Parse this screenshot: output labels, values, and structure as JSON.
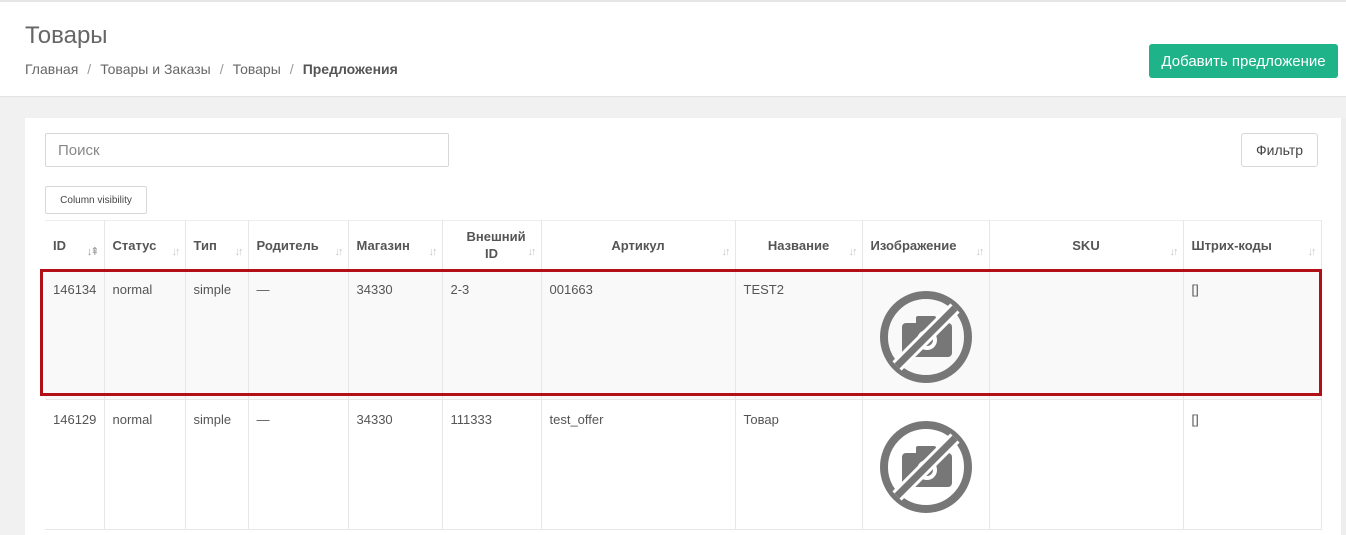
{
  "header": {
    "title": "Товары",
    "breadcrumb": [
      "Главная",
      "Товары и Заказы",
      "Товары",
      "Предложения"
    ],
    "add_button": "Добавить предложение"
  },
  "toolbar": {
    "search_placeholder": "Поиск",
    "filter_label": "Фильтр",
    "column_visibility_label": "Column visibility"
  },
  "table": {
    "columns": [
      "ID",
      "Статус",
      "Тип",
      "Родитель",
      "Магазин",
      "Внешний ID",
      "Артикул",
      "Название",
      "Изображение",
      "SKU",
      "Штрих-коды"
    ],
    "rows": [
      {
        "id": "146134",
        "status": "normal",
        "type": "simple",
        "parent": "—",
        "shop": "34330",
        "external_id": "2-3",
        "article": "001663",
        "name": "TEST2",
        "sku": "",
        "barcodes": "[]",
        "image": "no-photo-icon"
      },
      {
        "id": "146129",
        "status": "normal",
        "type": "simple",
        "parent": "—",
        "shop": "34330",
        "external_id": "111333",
        "article": "test_offer",
        "name": "Товар",
        "sku": "",
        "barcodes": "[]",
        "image": "no-photo-icon"
      }
    ]
  },
  "colors": {
    "accent": "#1fb38a",
    "highlight": "#b30f16"
  }
}
